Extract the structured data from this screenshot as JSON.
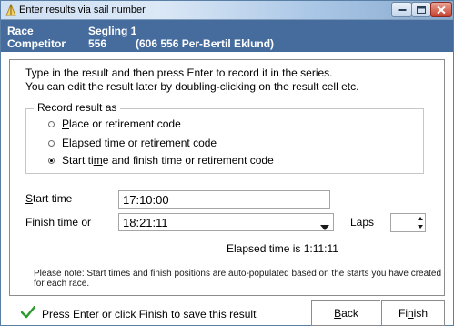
{
  "window": {
    "title": "Enter results via sail number"
  },
  "header": {
    "race_label": "Race",
    "race_value": "Segling 1",
    "competitor_label": "Competitor",
    "competitor_value": "556",
    "competitor_detail": "(606 556 Per-Bertil Eklund)"
  },
  "instructions": {
    "line1": "Type in the result and then press Enter to record it in the series.",
    "line2": "You can edit the result later by doubling-clicking on the result cell etc."
  },
  "record_group": {
    "legend": "Record result as",
    "options": [
      {
        "pre": "",
        "ul": "P",
        "post": "lace or retirement code",
        "selected": false
      },
      {
        "pre": "",
        "ul": "E",
        "post": "lapsed time or retirement code",
        "selected": false
      },
      {
        "pre": "Start ti",
        "ul": "m",
        "post": "e and finish time or retirement code",
        "selected": true
      }
    ]
  },
  "fields": {
    "start_label_ul": "S",
    "start_label_rest": "tart time",
    "start_value": "17:10:00",
    "finish_label": "Finish time or",
    "finish_value": "18:21:11",
    "laps_label": "Laps",
    "laps_value": ""
  },
  "elapsed_text": "Elapsed time is 1:11:11",
  "note": "Please note: Start times and finish positions are auto-populated based on the starts you have created for each race.",
  "footer": {
    "hint": "Press Enter or click Finish to save this result",
    "back_ul": "B",
    "back_rest": "ack",
    "finish_pre": "Fi",
    "finish_ul": "n",
    "finish_post": "ish"
  },
  "colors": {
    "header_bg": "#466c9e",
    "check_green": "#2e9a2e"
  }
}
